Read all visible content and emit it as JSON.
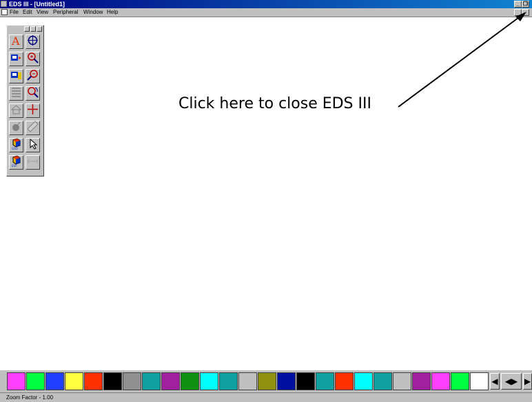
{
  "window": {
    "title": "EDS III - [Untitled1]"
  },
  "menu": {
    "items": [
      "File",
      "Edit",
      "View",
      "Peripheral",
      "Window",
      "Help"
    ]
  },
  "titlebar_buttons": {
    "minimize": "_",
    "restore": "❐"
  },
  "annotation": {
    "text": "Click here to close EDS III"
  },
  "toolbox": {
    "tools": [
      {
        "name": "text-tool-icon",
        "glyph": "A"
      },
      {
        "name": "crosshair-target-icon",
        "glyph": "⊕"
      },
      {
        "name": "add-node-icon",
        "glyph": ""
      },
      {
        "name": "zoom-in-icon",
        "glyph": ""
      },
      {
        "name": "label-node-icon",
        "glyph": ""
      },
      {
        "name": "zoom-out-icon",
        "glyph": ""
      },
      {
        "name": "list-icon",
        "glyph": ""
      },
      {
        "name": "zoom-rotate-icon",
        "glyph": ""
      },
      {
        "name": "house-icon",
        "glyph": ""
      },
      {
        "name": "pan-cross-icon",
        "glyph": ""
      },
      {
        "name": "bomb-icon",
        "glyph": ""
      },
      {
        "name": "ruler-icon",
        "glyph": ""
      },
      {
        "name": "gso-cube-icon",
        "glyph": "GSO"
      },
      {
        "name": "pointer-arrow-icon",
        "glyph": ""
      },
      {
        "name": "esp-cube-icon",
        "glyph": "ESP"
      },
      {
        "name": "dimension-icon",
        "glyph": ""
      }
    ]
  },
  "palette": {
    "colors": [
      "#ff40ff",
      "#00ff40",
      "#2040ff",
      "#ffff40",
      "#ff3000",
      "#000000",
      "#909090",
      "#10a0a0",
      "#a020a0",
      "#109010",
      "#00ffff",
      "#10a0a0",
      "#c0c0c0",
      "#909010",
      "#0010a0",
      "#000000",
      "#10a0a0",
      "#ff3000",
      "#00ffff",
      "#10a0a0",
      "#c0c0c0",
      "#a020a0",
      "#ff40ff",
      "#00ff40",
      "#ffffff"
    ],
    "nav": [
      "◀",
      "◀▶",
      "▶"
    ]
  },
  "status": {
    "zoom_label": "Zoom Factor - 1.00"
  }
}
